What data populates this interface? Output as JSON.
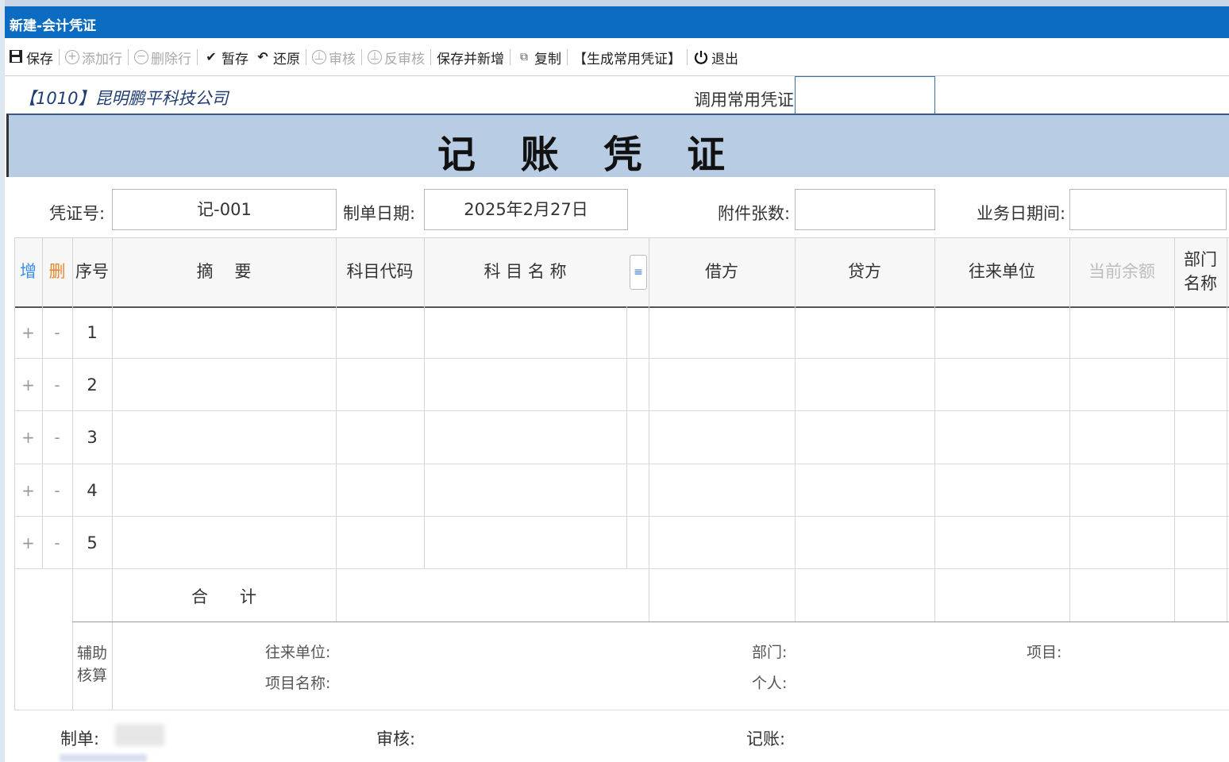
{
  "window": {
    "title": "新建-会计凭证"
  },
  "toolbar": {
    "save": "保存",
    "add_row": "添加行",
    "delete_row": "删除行",
    "temp_save": "暂存",
    "restore": "还原",
    "audit": "审核",
    "unaudit": "反审核",
    "save_and_new": "保存并新增",
    "copy": "复制",
    "generate_common": "【生成常用凭证】",
    "exit": "退出"
  },
  "company": "【1010】昆明鹏平科技公司",
  "invoke_common": {
    "label": "调用常用凭证",
    "value": ""
  },
  "voucher_title": "记 账 凭 证",
  "header": {
    "voucher_no_label": "凭证号:",
    "voucher_no": "记-001",
    "date_label": "制单日期:",
    "date": "2025年2月27日",
    "attachments_label": "附件张数:",
    "attachments": "",
    "biz_date_label": "业务日期间:",
    "biz_date": ""
  },
  "columns": {
    "add": "增",
    "del": "删",
    "seq": "序号",
    "summary": "摘    要",
    "account_code": "科目代码",
    "account_name": "科 目 名 称",
    "debit": "借方",
    "credit": "贷方",
    "counterparty": "往来单位",
    "balance": "当前余额",
    "dept_name": "部门名称"
  },
  "rows": [
    {
      "plus": "+",
      "minus": "-",
      "seq": "1"
    },
    {
      "plus": "+",
      "minus": "-",
      "seq": "2"
    },
    {
      "plus": "+",
      "minus": "-",
      "seq": "3"
    },
    {
      "plus": "+",
      "minus": "-",
      "seq": "4"
    },
    {
      "plus": "+",
      "minus": "-",
      "seq": "5"
    }
  ],
  "total_label": "合计",
  "aux": {
    "title": "辅助核算",
    "counterparty": "往来单位:",
    "dept": "部门:",
    "project": "项目:",
    "project_name": "项目名称:",
    "person": "个人:"
  },
  "footer": {
    "maker_label": "制单:",
    "audit_label": "审核:",
    "post_label": "记账:"
  },
  "colors": {
    "titlebar": "#0b6cc2",
    "banner": "#b8cce4",
    "add": "#3a8ee6",
    "del": "#e8862a"
  }
}
